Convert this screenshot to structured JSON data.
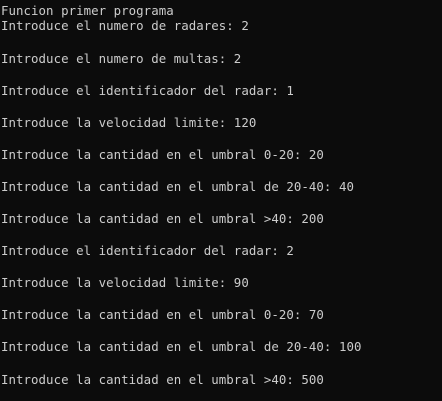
{
  "console": {
    "lines": [
      "Funcion primer programa",
      "Introduce el numero de radares: 2",
      "Introduce el numero de multas: 2",
      "Introduce el identificador del radar: 1",
      "Introduce la velocidad limite: 120",
      "Introduce la cantidad en el umbral 0-20: 20",
      "Introduce la cantidad en el umbral de 20-40: 40",
      "Introduce la cantidad en el umbral >40: 200",
      "Introduce el identificador del radar: 2",
      "Introduce la velocidad limite: 90",
      "Introduce la cantidad en el umbral 0-20: 70",
      "Introduce la cantidad en el umbral de 20-40: 100",
      "Introduce la cantidad en el umbral >40: 500"
    ],
    "colors": {
      "background": "#0c0c0c",
      "text": "#cccccc"
    }
  }
}
